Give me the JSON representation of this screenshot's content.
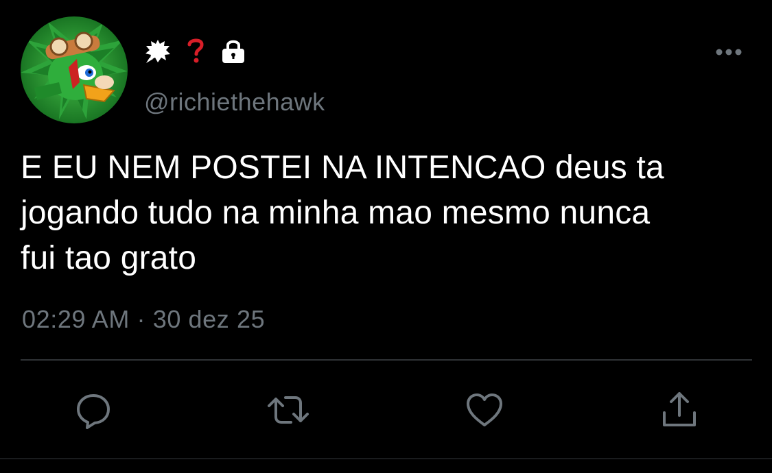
{
  "tweet": {
    "display_name_emojis": [
      "speech-burst-emoji",
      "red-question-mark-emoji",
      "lock-emoji"
    ],
    "handle": "@richiethehawk",
    "text": "E EU NEM POSTEI NA INTENCAO deus ta\njogando tudo na minha mao mesmo nunca\nfui tao grato",
    "timestamp": "02:29 AM · 30 dez 25"
  },
  "actions": [
    {
      "name": "reply",
      "icon": "speech-bubble-icon"
    },
    {
      "name": "retweet",
      "icon": "retweet-arrows-icon"
    },
    {
      "name": "like",
      "icon": "heart-icon"
    },
    {
      "name": "share",
      "icon": "upload-icon"
    }
  ],
  "colors": {
    "background": "#000000",
    "text_primary": "#ffffff",
    "text_secondary": "#6e767d",
    "divider": "#2f3336",
    "question_mark": "#d81e28",
    "avatar_bg": "#1f8a2a"
  }
}
